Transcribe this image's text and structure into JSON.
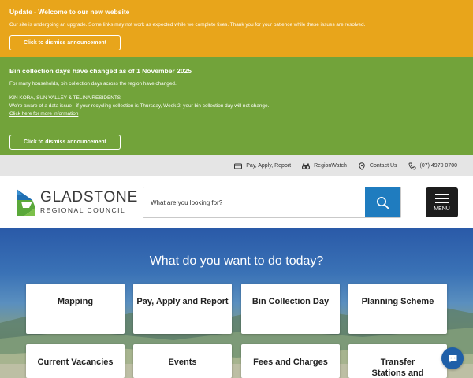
{
  "announcements": {
    "update": {
      "title": "Update - Welcome to our new website",
      "message": "Our site is undergoing an upgrade. Some links may not work as expected while we complete fixes. Thank you for your patience while these issues are resolved.",
      "dismiss_label": "Click to dismiss announcement",
      "color": "#e8a51b"
    },
    "bin": {
      "title": "Bin collection days have changed as of 1 November 2025",
      "message1": "For many households, bin collection days across the region have changed.",
      "message2": "KIN KORA, SUN VALLEY & TELINA RESIDENTS",
      "message3": "We're aware of a data issue - if your recycling collection is Thursday, Week 2, your bin collection day will not change.",
      "link_label": "Click here for more information",
      "dismiss_label": "Click to dismiss announcement",
      "color": "#72a33a"
    }
  },
  "utility_nav": [
    {
      "label": "Pay, Apply, Report",
      "icon": "card-icon"
    },
    {
      "label": "RegionWatch",
      "icon": "binoculars-icon"
    },
    {
      "label": "Contact Us",
      "icon": "location-pin-icon"
    },
    {
      "label": "(07) 4970 0700",
      "icon": "phone-icon"
    }
  ],
  "header": {
    "logo_name": "GLADSTONE",
    "logo_sub": "REGIONAL COUNCIL",
    "search_placeholder": "What are you looking for?",
    "menu_label": "MENU",
    "accent": "#1f7cbf"
  },
  "hero": {
    "title": "What do you want to do today?",
    "tiles": [
      "Mapping",
      "Pay, Apply and Report",
      "Bin Collection Day",
      "Planning Scheme",
      "Current Vacancies",
      "Events",
      "Fees and Charges",
      "Transfer Stations and Landfill"
    ]
  }
}
